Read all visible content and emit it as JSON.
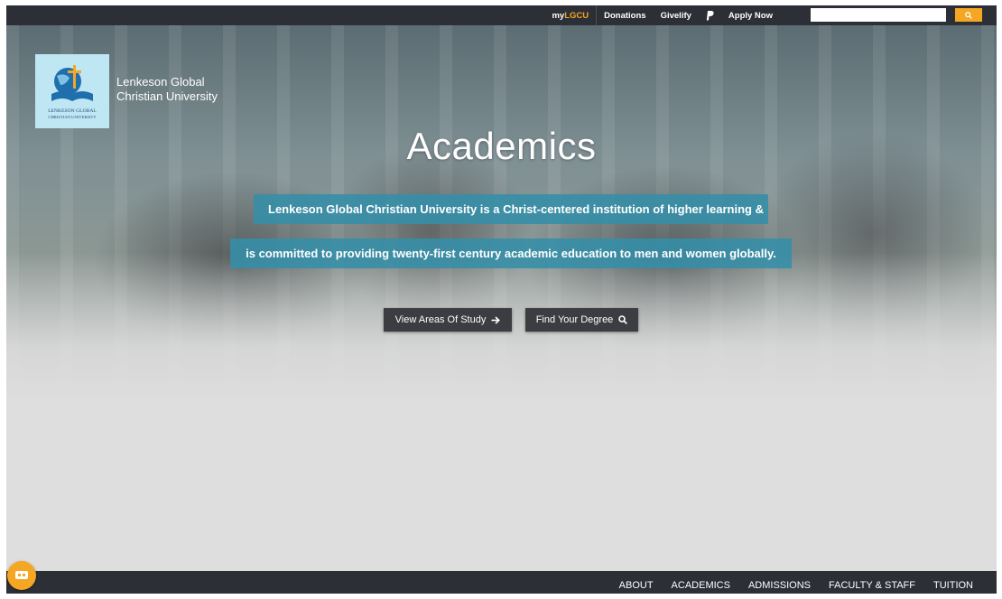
{
  "topbar": {
    "mylgcu_prefix": "my",
    "mylgcu_accent": "LGCU",
    "donations": "Donations",
    "givelify": "Givelify",
    "paypal_icon": "paypal-icon",
    "apply_now": "Apply Now",
    "search_placeholder": "",
    "search_icon": "search-icon"
  },
  "brand": {
    "line1": "Lenkeson Global",
    "line2": "Christian University",
    "logo_caption": "LENKESON GLOBAL CHRISTIAN UNIVERSITY"
  },
  "hero": {
    "title": "Academics",
    "tagline_1": "Lenkeson Global Christian University is a Christ-centered institution of higher learning &",
    "tagline_2": "is committed to providing twenty-first century academic education to men and women globally.",
    "cta_areas": "View Areas Of Study",
    "cta_degree": "Find Your Degree"
  },
  "nav": {
    "items": [
      "ABOUT",
      "ACADEMICS",
      "ADMISSIONS",
      "FACULTY & STAFF",
      "TUITION"
    ]
  },
  "colors": {
    "accent": "#f5a623",
    "bar": "#2c2f36",
    "tagline_bg": "#348ea8",
    "button_bg": "#3b3d42"
  }
}
